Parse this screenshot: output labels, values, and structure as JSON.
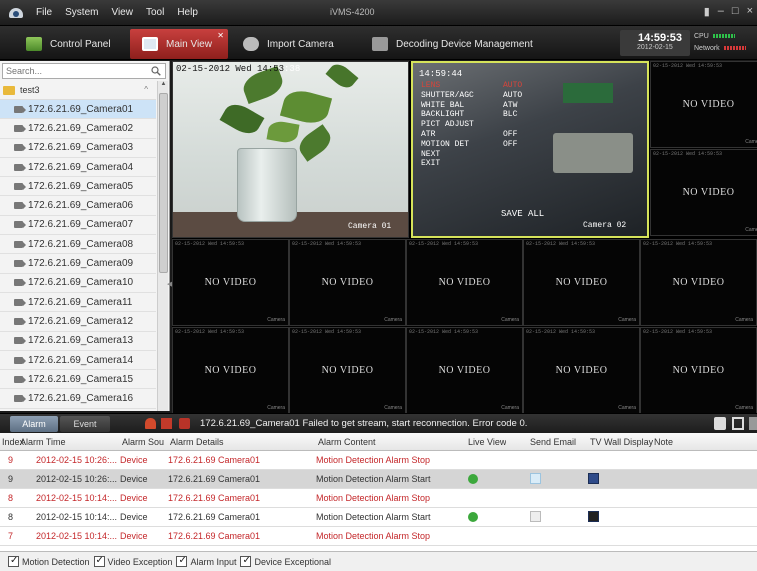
{
  "menubar": {
    "items": [
      "File",
      "System",
      "View",
      "Tool",
      "Help"
    ],
    "window_title": "iVMS-4200",
    "controls": [
      "▮",
      "–",
      "□",
      "×"
    ]
  },
  "tabs": {
    "control_panel": "Control Panel",
    "main_view": "Main View",
    "import_camera": "Import Camera",
    "decoding": "Decoding Device Management"
  },
  "clock": {
    "time": "14:59:53",
    "date": "2012-02-15"
  },
  "stats": {
    "cpu_label": "CPU",
    "network_label": "Network"
  },
  "sidebar": {
    "search_placeholder": "Search...",
    "group": "test3",
    "cameras": [
      "172.6.21.69_Camera01",
      "172.6.21.69_Camera02",
      "172.6.21.69_Camera03",
      "172.6.21.69_Camera04",
      "172.6.21.69_Camera05",
      "172.6.21.69_Camera06",
      "172.6.21.69_Camera07",
      "172.6.21.69_Camera08",
      "172.6.21.69_Camera09",
      "172.6.21.69_Camera10",
      "172.6.21.69_Camera11",
      "172.6.21.69_Camera12",
      "172.6.21.69_Camera13",
      "172.6.21.69_Camera14",
      "172.6.21.69_Camera15",
      "172.6.21.69_Camera16"
    ]
  },
  "video": {
    "cell1_timestamp": "02-15-2012 Wed 14:53",
    "cell1_seconds": ":38",
    "cell1_name": "Camera 01",
    "cell2_timestamp": "14:59:44",
    "cell2_name": "Camera 02",
    "cell2_save": "SAVE ALL",
    "osd_labels": [
      "LENS",
      "SHUTTER/AGC",
      "WHITE BAL",
      "BACKLIGHT",
      "PICT ADJUST",
      "ATR",
      "MOTION DET",
      "NEXT",
      "EXIT"
    ],
    "osd_values": [
      "AUTO",
      "AUTO",
      "ATW",
      "BLC",
      "",
      "OFF",
      "OFF",
      "",
      ""
    ],
    "no_video": "NO VIDEO",
    "tiny_ts": "02-15-2012 Wed 14:59:53",
    "tiny_cam": "Camera"
  },
  "alarm": {
    "tab_alarm": "Alarm",
    "tab_event": "Event",
    "status_message": "172.6.21.69_Camera01 Failed to get stream, start reconnection. Error code 0.",
    "headers": [
      "Index",
      "Alarm Time",
      "Alarm Sou",
      "Alarm Details",
      "Alarm Content",
      "Live View",
      "Send Email",
      "TV Wall Display",
      "Note"
    ],
    "rows": [
      {
        "index": "9",
        "time": "2012-02-15 10:26:...",
        "source": "Device",
        "details": "172.6.21.69 Camera01",
        "content": "Motion Detection Alarm Stop"
      },
      {
        "index": "9",
        "time": "2012-02-15 10:26:...",
        "source": "Device",
        "details": "172.6.21.69 Camera01",
        "content": "Motion Detection Alarm Start"
      },
      {
        "index": "8",
        "time": "2012-02-15 10:14:...",
        "source": "Device",
        "details": "172.6.21.69 Camera01",
        "content": "Motion Detection Alarm Stop"
      },
      {
        "index": "8",
        "time": "2012-02-15 10:14:...",
        "source": "Device",
        "details": "172.6.21.69 Camera01",
        "content": "Motion Detection Alarm Start"
      },
      {
        "index": "7",
        "time": "2012-02-15 10:14:...",
        "source": "Device",
        "details": "172.6.21.69 Camera01",
        "content": "Motion Detection Alarm Stop"
      }
    ]
  },
  "filters": [
    "Motion Detection",
    "Video Exception",
    "Alarm Input",
    "Device Exceptional"
  ],
  "colors": {
    "accent_red": "#c4272a",
    "selected_tab": "#c8403e",
    "highlight_border": "#d6e35a"
  }
}
